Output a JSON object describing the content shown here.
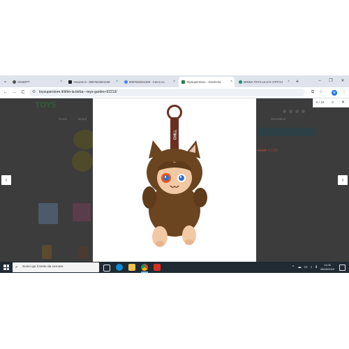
{
  "browser": {
    "tabs": [
      {
        "label": "ChatGPT",
        "active": false,
        "fav_color": "#555555"
      },
      {
        "label": "Amazon.it - 8057622921159",
        "active": false,
        "fav_color": "#222222"
      },
      {
        "label": "8057622921159 - Cerca co",
        "active": false,
        "fav_color": "#4285f4"
      },
      {
        "label": "ToySuperStore - Giocheria",
        "active": true,
        "fav_color": "#2f7a4a"
      },
      {
        "label": "MINNA TOYS LILO E STITCH",
        "active": false,
        "fav_color": "#1a8f6f"
      }
    ],
    "tab_close_glyph": "×",
    "new_tab_glyph": "+",
    "menu_glyph": "⌄",
    "window_controls": [
      "–",
      "❐",
      "✕"
    ],
    "nav": {
      "back": "←",
      "forward": "→",
      "reload": "C",
      "home": "⌂"
    },
    "url": "toysuperstore.it/it/tm-la-birba---toys-garden-92213/",
    "toolbar_icons": [
      "⧉",
      "☆",
      "⊕",
      "⋮"
    ],
    "find_bar": {
      "count": "6 / 10",
      "search_glyph": "⌕",
      "close_glyph": "✕"
    }
  },
  "site": {
    "logo": "TOYS",
    "menu": [
      "Home",
      "Brand",
      "Rivenditori"
    ],
    "price_old": "€ 8,99",
    "price_new": "€ 6,99"
  },
  "lightbox": {
    "prev_glyph": "‹",
    "next_glyph": "›",
    "tag_text": "CHILL"
  },
  "taskbar": {
    "search_placeholder": "Scrivi qui il testo da cercare",
    "search_glyph": "⌕",
    "tray_glyphs": [
      "^",
      "☁",
      "▭",
      "♪",
      "ℹ"
    ],
    "time": "11:06",
    "date": "06/05/2025"
  },
  "colors": {
    "tab_strip": "#dfe3eb",
    "plush_fur": "#6b4420",
    "plush_face": "#f2c9a5",
    "strap": "#6b2f22",
    "taskbar": "#1f2a33"
  }
}
